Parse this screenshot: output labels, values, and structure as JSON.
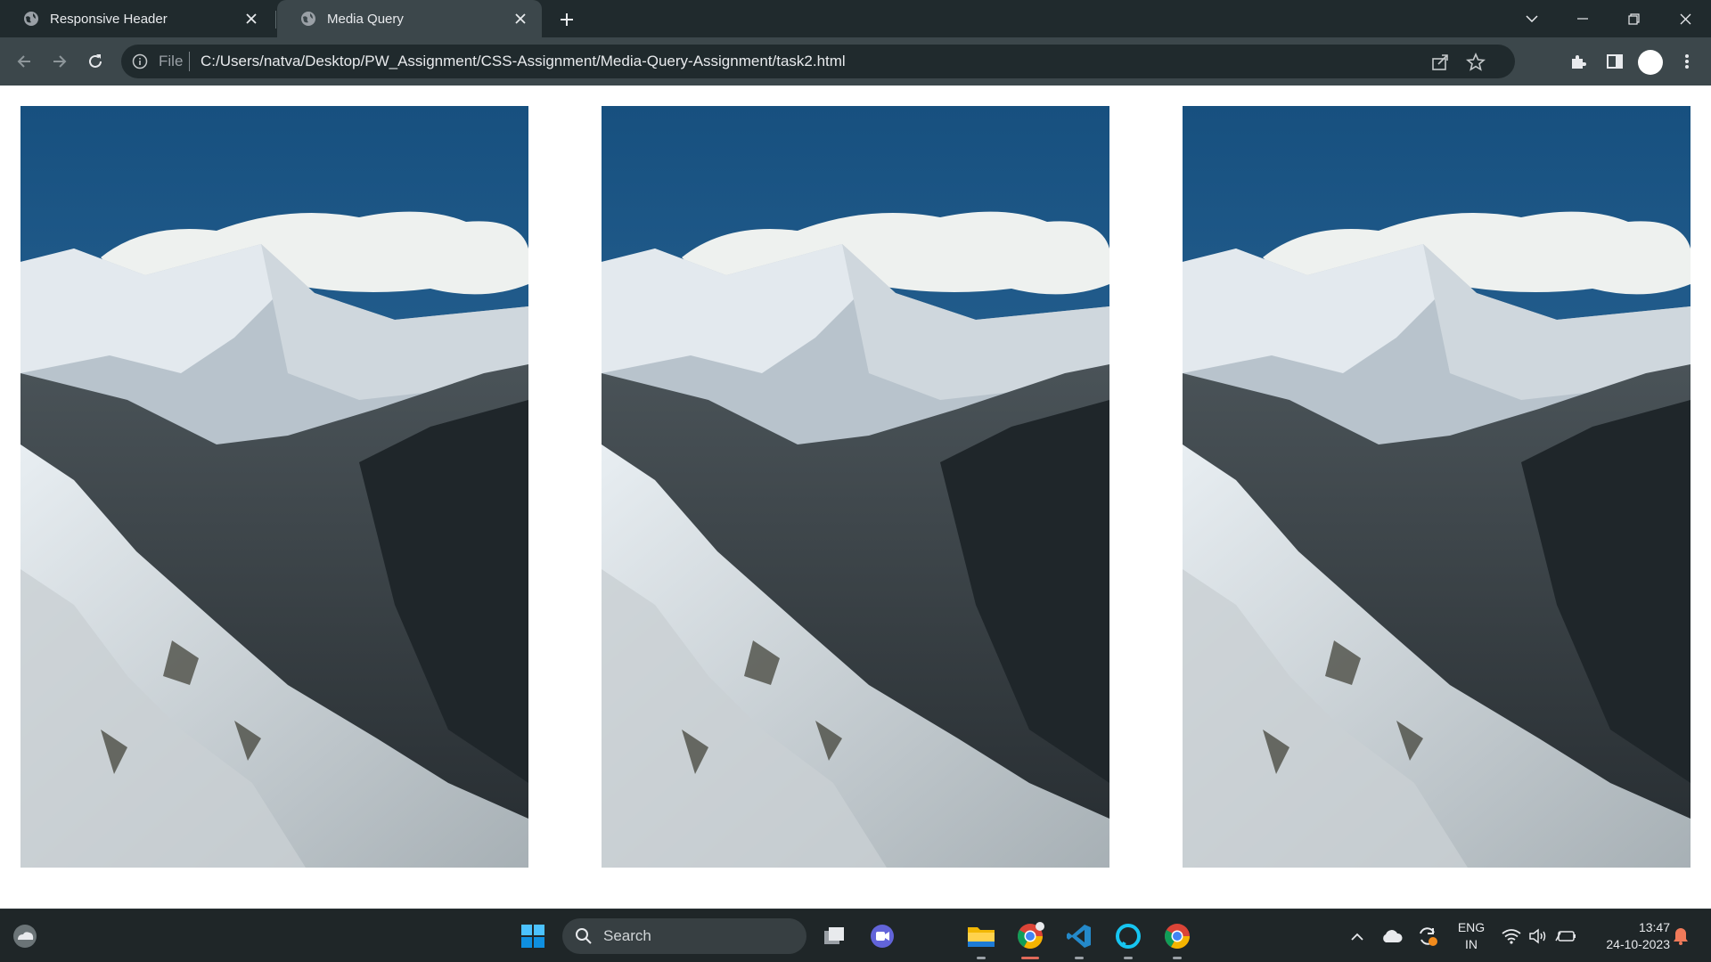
{
  "browser": {
    "tabs": [
      {
        "title": "Responsive Header",
        "active": false
      },
      {
        "title": "Media Query",
        "active": true
      }
    ],
    "address": {
      "scheme_label": "File",
      "url": "C:/Users/natva/Desktop/PW_Assignment/CSS-Assignment/Media-Query-Assignment/task2.html"
    }
  },
  "page": {
    "images": [
      {
        "subject": "Snow-covered Himalayan mountain valley under blue sky with clouds"
      },
      {
        "subject": "Snow-covered Himalayan mountain valley under blue sky with clouds"
      },
      {
        "subject": "Snow-covered Himalayan mountain valley under blue sky with clouds"
      }
    ]
  },
  "taskbar": {
    "search_label": "Search",
    "apps": [
      "windows-start",
      "search",
      "task-view",
      "teams-chat",
      "file-explorer",
      "chrome",
      "vscode",
      "alexa",
      "chrome-alt"
    ],
    "active_app": "chrome",
    "tray": {
      "language_line1": "ENG",
      "language_line2": "IN",
      "time": "13:47",
      "date": "24-10-2023"
    }
  },
  "colors": {
    "tabstrip_bg": "#202a2d",
    "toolbar_bg": "#3c474b",
    "omnibox_bg": "#202a2d",
    "taskbar_bg": "#1f2628",
    "sky": "#1d5482",
    "page_bg": "#ffffff"
  }
}
